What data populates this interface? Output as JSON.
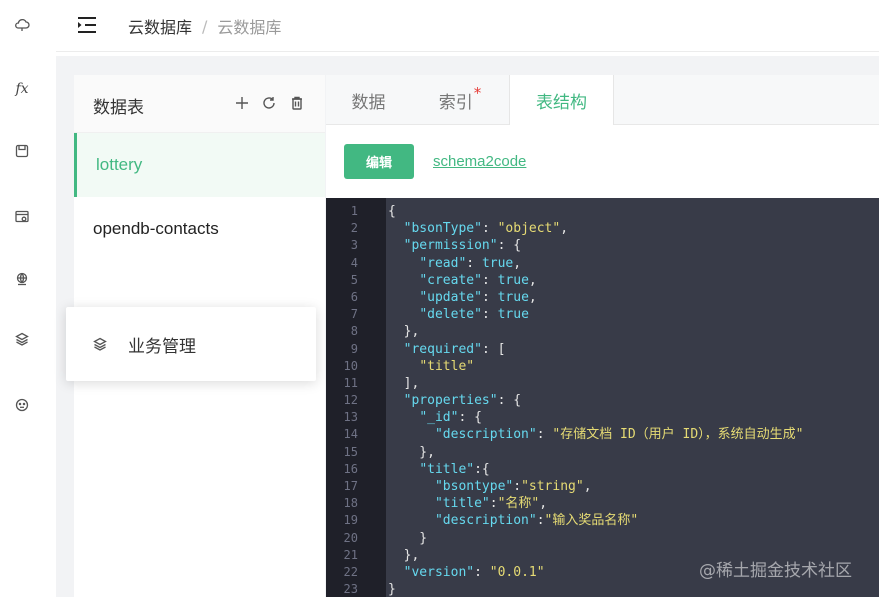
{
  "header": {
    "breadcrumb": [
      "云数据库",
      "云数据库"
    ],
    "separator": "/"
  },
  "rail": {
    "icons": [
      "cloud-icon",
      "fx-icon",
      "storage-icon",
      "browser-db-icon",
      "globe-icon",
      "layers-icon",
      "face-icon"
    ],
    "fx_label": "fx"
  },
  "tables_panel": {
    "title": "数据表",
    "items": [
      {
        "label": "lottery",
        "active": true
      },
      {
        "label": "opendb-contacts",
        "active": false
      }
    ]
  },
  "popup_menu": {
    "label": "业务管理"
  },
  "tabs": [
    {
      "label": "数据",
      "active": false
    },
    {
      "label": "索引",
      "active": false,
      "badge": "*"
    },
    {
      "label": "表结构",
      "active": true
    }
  ],
  "toolbar": {
    "edit_label": "编辑",
    "link_label": "schema2code"
  },
  "editor": {
    "lines": [
      "1",
      "2",
      "3",
      "4",
      "5",
      "6",
      "7",
      "8",
      "9",
      "10",
      "11",
      "12",
      "13",
      "14",
      "15",
      "16",
      "17",
      "18",
      "19",
      "20",
      "21",
      "22",
      "23"
    ]
  },
  "watermark": "@稀土掘金技术社区",
  "colors": {
    "accent": "#42b882",
    "editor_bg": "#383b48",
    "gutter_bg": "#1f2029",
    "badge": "#e53935"
  }
}
